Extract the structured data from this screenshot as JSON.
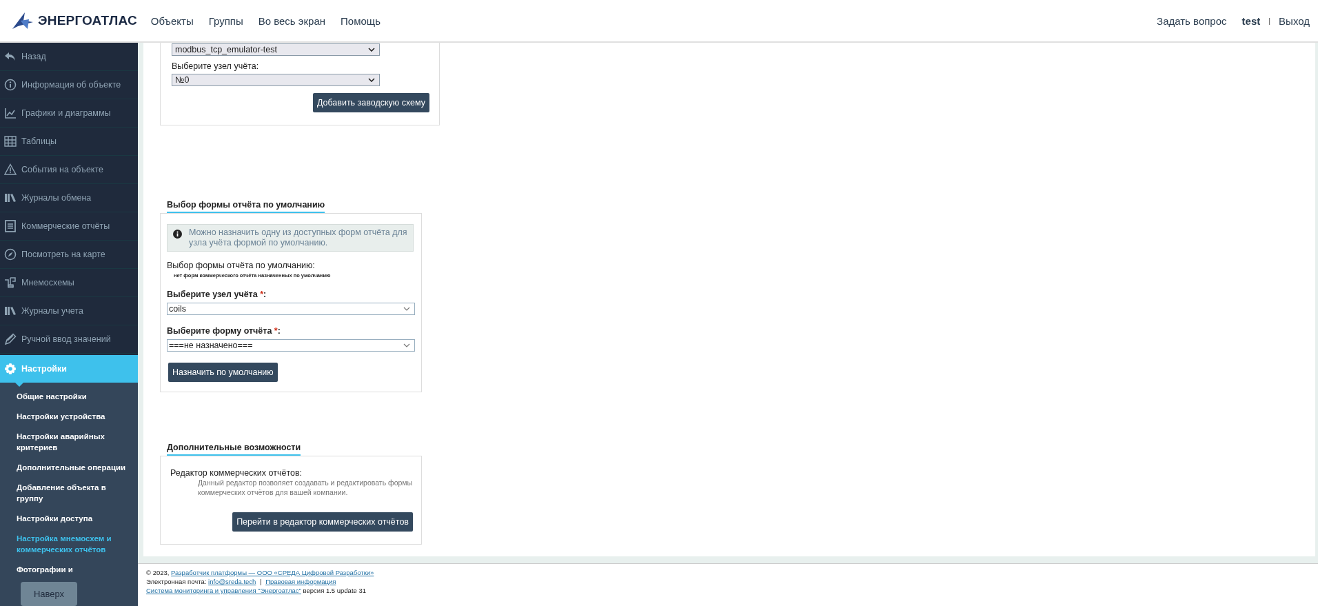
{
  "header": {
    "logo": "ЭНЕРГОАТЛАС",
    "nav": [
      "Объекты",
      "Группы",
      "Во весь экран",
      "Помощь"
    ],
    "ask": "Задать вопрос",
    "user": "test",
    "separator": "|",
    "logout": "Выход"
  },
  "sidebar": {
    "items": [
      {
        "label": "Назад",
        "selected": false
      },
      {
        "label": "Информация об объекте",
        "selected": false
      },
      {
        "label": "Графики и диаграммы",
        "selected": false
      },
      {
        "label": "Таблицы",
        "selected": false
      },
      {
        "label": "События на объекте",
        "selected": false
      },
      {
        "label": "Журналы обмена",
        "selected": false
      },
      {
        "label": "Коммерческие отчёты",
        "selected": false
      },
      {
        "label": "Посмотреть на карте",
        "selected": false
      },
      {
        "label": "Мнемосхемы",
        "selected": false
      },
      {
        "label": "Журналы учета",
        "selected": false
      },
      {
        "label": "Ручной ввод значений",
        "selected": false
      },
      {
        "label": "Настройки",
        "selected": true
      }
    ],
    "subitems": [
      {
        "label": "Общие настройки",
        "selected": false
      },
      {
        "label": "Настройки устройства",
        "selected": false
      },
      {
        "label": "Настройки аварийных критериев",
        "selected": false
      },
      {
        "label": "Дополнительные операции",
        "selected": false
      },
      {
        "label": "Добавление объекта в группу",
        "selected": false
      },
      {
        "label": "Настройки доступа",
        "selected": false
      },
      {
        "label": "Настройка мнемосхем и коммерческих отчётов",
        "selected": true
      },
      {
        "label": "Фотографии и",
        "selected": false
      }
    ],
    "top_button": "Наверх"
  },
  "factory_scheme": {
    "device_select": "modbus_tcp_emulator-test",
    "node_label": "Выберите узел учёта:",
    "node_select": "№0",
    "button": "Добавить заводскую схему"
  },
  "default_form": {
    "title": "Выбор формы отчёта по умолчанию",
    "info": "Можно назначить одну из доступных форм отчёта для узла учёта формой по умолчанию.",
    "current_label": "Выбор формы отчёта по умолчанию:",
    "current_value": "нет форм коммерческого отчёта назначенных по умолчанию",
    "fields": [
      {
        "label": "Выберите узел учёта ",
        "required_mark": "*",
        "label_end": ":",
        "value": "coils"
      },
      {
        "label": "Выберите форму отчёта ",
        "required_mark": "*",
        "label_end": ":",
        "value": "===не назначено==="
      }
    ],
    "button": "Назначить по умолчанию"
  },
  "extra": {
    "title": "Дополнительные возможности",
    "editor_label": "Редактор коммерческих отчётов:",
    "editor_description": "Данный редактор позволяет создавать и редактировать формы коммерческих отчётов для вашей компании.",
    "button": "Перейти в редактор коммерческих отчётов"
  },
  "footer": {
    "copyright": "© 2023,",
    "developer_link": "Разработчик платформы — ООО «СРЕДА Цифровой Разработки»",
    "email_label": "Электронная почта:",
    "email_link": "info@sreda.tech",
    "separator": "|",
    "legal_link": "Правовая информация",
    "system_link": "Система мониторинга и управления \"Энергоатлас\"",
    "version": "версия 1.5 update 31"
  }
}
